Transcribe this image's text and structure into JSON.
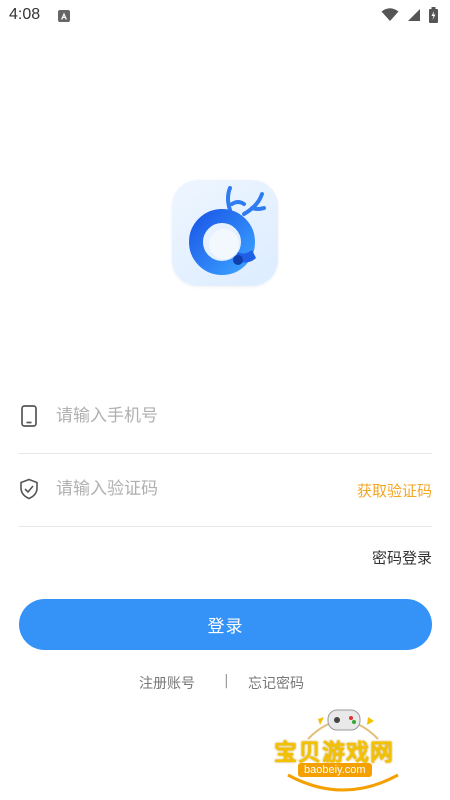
{
  "status_bar": {
    "time": "4:08",
    "icons": [
      "notification-a-icon",
      "wifi-icon",
      "signal-icon",
      "battery-icon"
    ]
  },
  "logo": {
    "icon": "app-logo-deer",
    "accent": "#1f6ff0"
  },
  "form": {
    "phone": {
      "icon": "phone-icon",
      "placeholder": "请输入手机号",
      "value": ""
    },
    "code": {
      "icon": "shield-check-icon",
      "placeholder": "请输入验证码",
      "value": "",
      "get_code_label": "获取验证码"
    }
  },
  "password_login_label": "密码登录",
  "login_button_label": "登录",
  "links": {
    "register": "注册账号",
    "divider": "|",
    "forgot": "忘记密码"
  },
  "watermark": {
    "title": "宝贝游戏网",
    "url": "baobeiy.com"
  },
  "colors": {
    "primary": "#3592f7",
    "accent_orange": "#f5a623",
    "divider": "#e6e6e6"
  }
}
